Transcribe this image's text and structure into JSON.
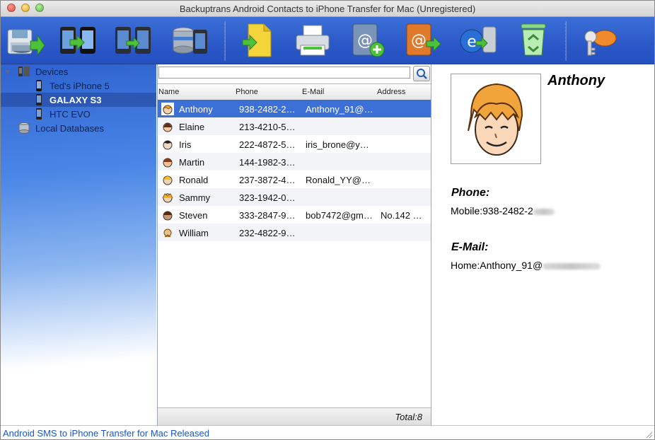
{
  "window": {
    "title": "Backuptrans Android Contacts to iPhone Transfer for Mac (Unregistered)"
  },
  "toolbar": {
    "tools": [
      {
        "name": "backup-to-database-icon"
      },
      {
        "name": "transfer-android-to-iphone-icon"
      },
      {
        "name": "transfer-phone-to-phone-icon"
      },
      {
        "name": "restore-database-to-phone-icon"
      },
      {
        "name": "export-file-icon"
      },
      {
        "name": "print-icon"
      },
      {
        "name": "add-contact-icon"
      },
      {
        "name": "export-to-address-book-icon"
      },
      {
        "name": "import-from-computer-icon"
      },
      {
        "name": "delete-recycle-icon"
      },
      {
        "name": "register-key-icon"
      }
    ]
  },
  "sidebar": {
    "root": "Devices",
    "devices": [
      "Ted's iPhone 5",
      "GALAXY S3",
      "HTC EVO"
    ],
    "selected": "GALAXY S3",
    "local": "Local Databases"
  },
  "list": {
    "search": {
      "value": "",
      "placeholder": ""
    },
    "columns": {
      "name": "Name",
      "phone": "Phone",
      "email": "E-Mail",
      "address": "Address"
    },
    "rows": [
      {
        "name": "Anthony",
        "phone": "938-2482-2…",
        "email": "Anthony_91@…",
        "address": ""
      },
      {
        "name": "Elaine",
        "phone": "213-4210-5…",
        "email": "",
        "address": ""
      },
      {
        "name": "Iris",
        "phone": "222-4872-5…",
        "email": "iris_brone@y…",
        "address": ""
      },
      {
        "name": "Martin",
        "phone": "144-1982-3…",
        "email": "",
        "address": ""
      },
      {
        "name": "Ronald",
        "phone": "237-3872-4…",
        "email": "Ronald_YY@…",
        "address": ""
      },
      {
        "name": "Sammy",
        "phone": "323-1942-0…",
        "email": "",
        "address": ""
      },
      {
        "name": "Steven",
        "phone": "333-2847-9…",
        "email": "bob7472@gm…",
        "address": "No.142 …"
      },
      {
        "name": "William",
        "phone": "232-4822-9…",
        "email": "",
        "address": ""
      }
    ],
    "selected_row": "Anthony",
    "total": "Total:8"
  },
  "detail": {
    "name": "Anthony",
    "phone_heading": "Phone:",
    "phone_value": "Mobile:938-2482-2",
    "email_heading": "E-Mail:",
    "email_value": "Home:Anthony_91@"
  },
  "statusbar": {
    "link": "Android SMS to iPhone Transfer for Mac Released"
  },
  "colors": {
    "toolbar_blue": "#2a58c8",
    "selection_blue": "#3d70d6",
    "link_blue": "#1b55c4"
  }
}
